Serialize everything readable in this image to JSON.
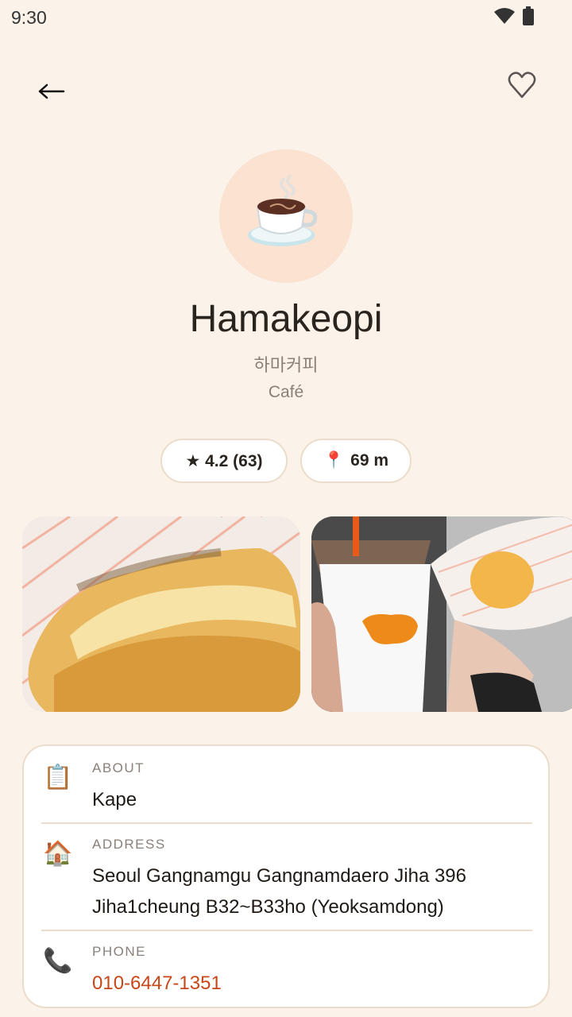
{
  "status_bar": {
    "time": "9:30"
  },
  "header": {
    "back_icon": "arrow-left-icon",
    "favorite_icon": "heart-outline-icon"
  },
  "place": {
    "emoji": "☕",
    "name": "Hamakeopi",
    "name_local": "하마커피",
    "category": "Café"
  },
  "chips": {
    "rating": "★ 4.2 (63)",
    "distance_icon": "📍",
    "distance": "69 m"
  },
  "details": {
    "about": {
      "label": "ABOUT",
      "value": "Kape",
      "icon": "📋"
    },
    "address": {
      "label": "ADDRESS",
      "value": "Seoul Gangnamgu Gangnamdaero Jiha 396 Jiha1cheung B32~B33ho (Yeoksamdong)",
      "icon": "🏠"
    },
    "phone": {
      "label": "PHONE",
      "value": "010-6447-1351",
      "icon": "📞"
    }
  },
  "colors": {
    "background": "#fbf3ea",
    "accent": "#c8471a",
    "avatar_bg": "#fbe2d1"
  }
}
